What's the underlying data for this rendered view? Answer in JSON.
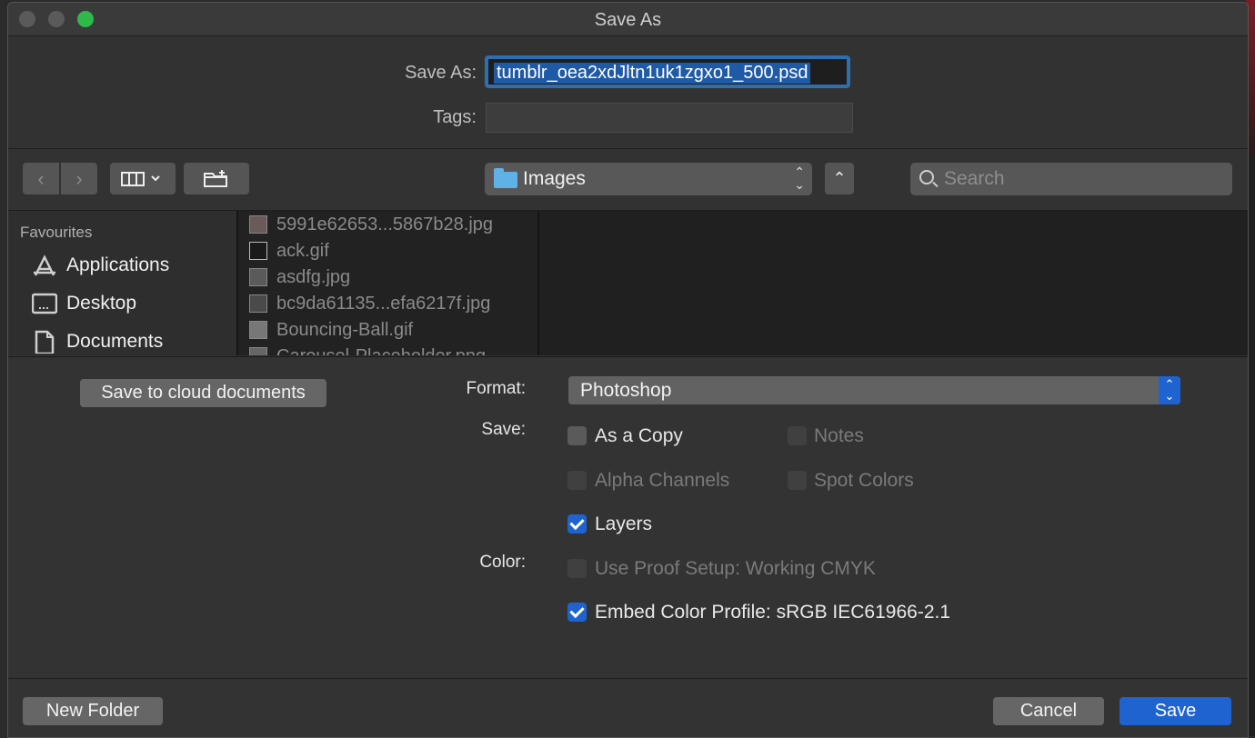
{
  "window": {
    "title": "Save As"
  },
  "form": {
    "save_as_label": "Save As:",
    "save_as_value": "tumblr_oea2xdJltn1uk1zgxo1_500.psd",
    "tags_label": "Tags:",
    "tags_value": ""
  },
  "toolbar": {
    "location": "Images",
    "search_placeholder": "Search"
  },
  "sidebar": {
    "heading": "Favourites",
    "items": [
      {
        "label": "Applications",
        "icon": "applications-icon"
      },
      {
        "label": "Desktop",
        "icon": "desktop-icon"
      },
      {
        "label": "Documents",
        "icon": "documents-icon"
      }
    ]
  },
  "files": [
    {
      "name": "5991e62653...5867b28.jpg"
    },
    {
      "name": "ack.gif"
    },
    {
      "name": "asdfg.jpg"
    },
    {
      "name": "bc9da61135...efa6217f.jpg"
    },
    {
      "name": "Bouncing-Ball.gif"
    },
    {
      "name": "Carousel-Placeholder.png"
    }
  ],
  "options": {
    "cloud_button": "Save to cloud documents",
    "format_label": "Format:",
    "format_value": "Photoshop",
    "save_label": "Save:",
    "color_label": "Color:",
    "as_a_copy": {
      "label": "As a Copy",
      "checked": false,
      "enabled": true
    },
    "notes": {
      "label": "Notes",
      "checked": false,
      "enabled": false
    },
    "alpha_channels": {
      "label": "Alpha Channels",
      "checked": false,
      "enabled": false
    },
    "spot_colors": {
      "label": "Spot Colors",
      "checked": false,
      "enabled": false
    },
    "layers": {
      "label": "Layers",
      "checked": true,
      "enabled": true
    },
    "use_proof_setup": {
      "label": "Use Proof Setup:  Working CMYK",
      "checked": false,
      "enabled": false
    },
    "embed_color_profile": {
      "label": "Embed Color Profile:  sRGB IEC61966-2.1",
      "checked": true,
      "enabled": true
    }
  },
  "buttons": {
    "new_folder": "New Folder",
    "cancel": "Cancel",
    "save": "Save"
  },
  "colors": {
    "accent": "#1f63d1",
    "focus_ring": "#2f6fae",
    "folder": "#5fb1e6"
  }
}
